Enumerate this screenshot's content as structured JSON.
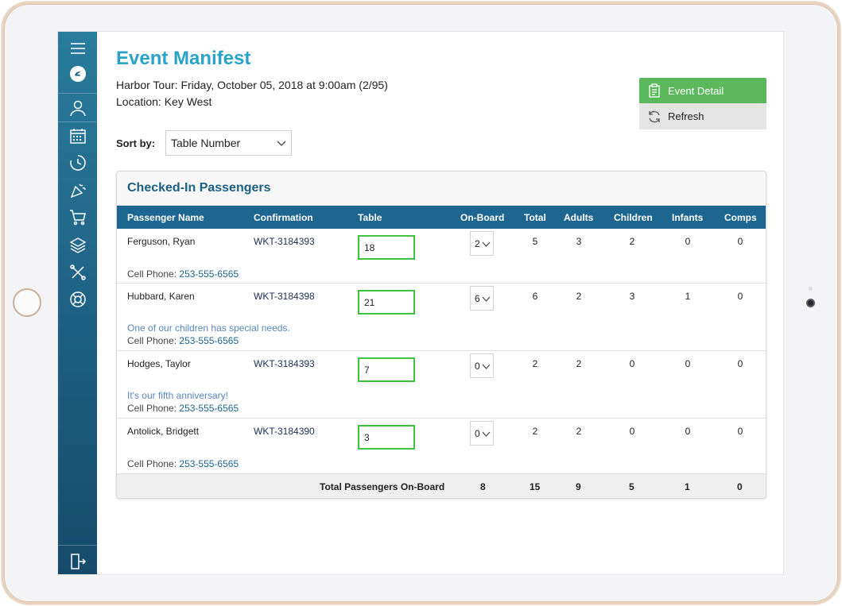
{
  "header": {
    "title": "Event Manifest",
    "event_line": "Harbor Tour: Friday, October 05, 2018 at 9:00am (2/95)",
    "location_line": "Location: Key West"
  },
  "actions": {
    "event_detail_label": "Event Detail",
    "refresh_label": "Refresh"
  },
  "sort": {
    "label": "Sort by:",
    "selected": "Table Number"
  },
  "panel": {
    "title": "Checked-In Passengers",
    "columns": [
      "Passenger Name",
      "Confirmation",
      "Table",
      "On-Board",
      "Total",
      "Adults",
      "Children",
      "Infants",
      "Comps"
    ],
    "rows": [
      {
        "name": "Ferguson, Ryan",
        "confirmation": "WKT-3184393",
        "table": "18",
        "onboard": "2",
        "total": "5",
        "adults": "3",
        "children": "2",
        "infants": "0",
        "comps": "0",
        "note": "",
        "phone_label": "Cell Phone:",
        "phone": "253-555-6565"
      },
      {
        "name": "Hubbard, Karen",
        "confirmation": "WKT-3184398",
        "table": "21",
        "onboard": "6",
        "total": "6",
        "adults": "2",
        "children": "3",
        "infants": "1",
        "comps": "0",
        "note": "One of our children has special needs.",
        "phone_label": "Cell Phone:",
        "phone": "253-555-6565"
      },
      {
        "name": "Hodges, Taylor",
        "confirmation": "WKT-3184393",
        "table": "7",
        "onboard": "0",
        "total": "2",
        "adults": "2",
        "children": "0",
        "infants": "0",
        "comps": "0",
        "note": "It's our fifth anniversary!",
        "phone_label": "Cell Phone:",
        "phone": "253-555-6565"
      },
      {
        "name": "Antolick, Bridgett",
        "confirmation": "WKT-3184390",
        "table": "3",
        "onboard": "0",
        "total": "2",
        "adults": "2",
        "children": "0",
        "infants": "0",
        "comps": "0",
        "note": "",
        "phone_label": "Cell Phone:",
        "phone": "253-555-6565"
      }
    ],
    "footer": {
      "label": "Total Passengers On-Board",
      "onboard": "8",
      "total": "15",
      "adults": "9",
      "children": "5",
      "infants": "1",
      "comps": "0"
    }
  },
  "sidebar": {
    "items": [
      "menu-icon",
      "logo-icon",
      "user-icon",
      "calendar-icon",
      "clock-icon",
      "party-icon",
      "cart-icon",
      "layers-icon",
      "tools-icon",
      "lifebuoy-icon",
      "exit-icon"
    ]
  },
  "colors": {
    "sidebar": "#1d5f82",
    "accent": "#2aa3c9",
    "table_header": "#1d6690",
    "primary_button": "#5cb85c",
    "table_input_border": "#3ec33e"
  }
}
